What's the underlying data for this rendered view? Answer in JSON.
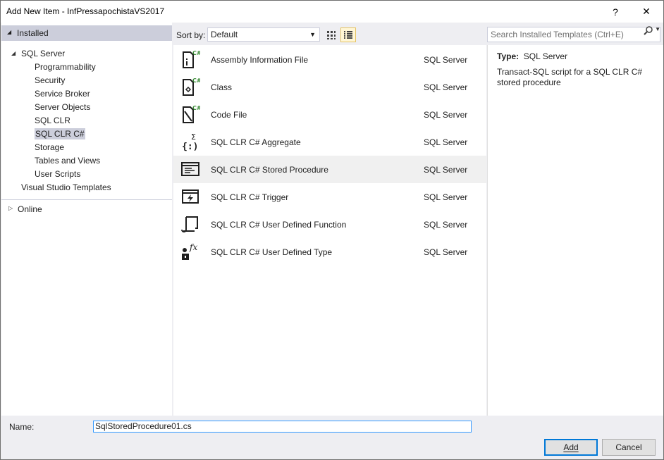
{
  "window": {
    "title": "Add New Item - InfPressapochistaVS2017",
    "help_label": "?",
    "close_label": "✕"
  },
  "left": {
    "installed_label": "Installed",
    "sql_server_label": "SQL Server",
    "children": [
      "Programmability",
      "Security",
      "Service Broker",
      "Server Objects",
      "SQL CLR",
      "SQL CLR C#",
      "Storage",
      "Tables and Views",
      "User Scripts"
    ],
    "selected_child": "SQL CLR C#",
    "vs_templates_label": "Visual Studio Templates",
    "online_label": "Online"
  },
  "toolbar": {
    "sortby_label": "Sort by:",
    "sort_value": "Default"
  },
  "search": {
    "placeholder": "Search Installed Templates (Ctrl+E)"
  },
  "templates": [
    {
      "name": "Assembly Information File",
      "category": "SQL Server",
      "icon": "assembly-info-icon"
    },
    {
      "name": "Class",
      "category": "SQL Server",
      "icon": "class-icon"
    },
    {
      "name": "Code File",
      "category": "SQL Server",
      "icon": "code-file-icon"
    },
    {
      "name": "SQL CLR C# Aggregate",
      "category": "SQL Server",
      "icon": "aggregate-icon"
    },
    {
      "name": "SQL CLR C# Stored Procedure",
      "category": "SQL Server",
      "icon": "stored-procedure-icon"
    },
    {
      "name": "SQL CLR C# Trigger",
      "category": "SQL Server",
      "icon": "trigger-icon"
    },
    {
      "name": "SQL CLR C# User Defined Function",
      "category": "SQL Server",
      "icon": "function-icon"
    },
    {
      "name": "SQL CLR C# User Defined Type",
      "category": "SQL Server",
      "icon": "user-defined-type-icon"
    }
  ],
  "selected_template": "SQL CLR C# Stored Procedure",
  "details": {
    "type_label": "Type:",
    "type_value": "SQL Server",
    "description": "Transact-SQL script for a SQL CLR C# stored procedure"
  },
  "bottom": {
    "name_label": "Name:",
    "name_value": "SqlStoredProcedure01.cs",
    "add_label": "Add",
    "cancel_label": "Cancel"
  },
  "colors": {
    "selection": "#cccedb",
    "csharp_green": "#388a34",
    "focus_blue": "#3399ff"
  }
}
